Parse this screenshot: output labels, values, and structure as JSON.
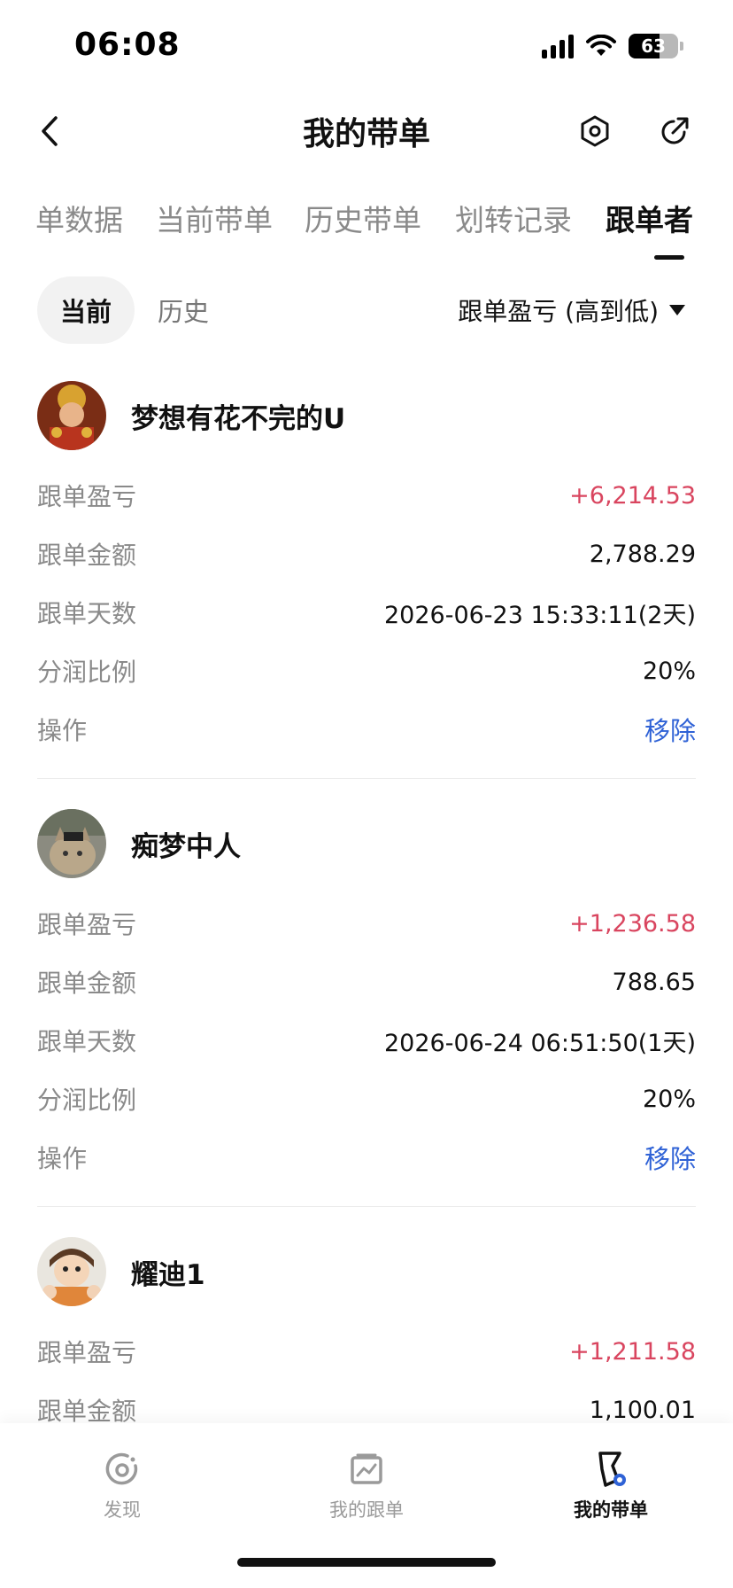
{
  "status_bar": {
    "time": "06:08",
    "battery": "63",
    "battery_level_pct": 63
  },
  "nav": {
    "title": "我的带单",
    "back_icon": "chevron-left-icon",
    "settings_icon": "hexagon-gear-icon",
    "share_icon": "share-arrow-icon"
  },
  "tabs": [
    {
      "label": "单数据"
    },
    {
      "label": "当前带单"
    },
    {
      "label": "历史带单"
    },
    {
      "label": "划转记录"
    },
    {
      "label": "跟单者"
    }
  ],
  "active_tab": "跟单者",
  "filter": {
    "current": "当前",
    "history": "历史",
    "sort_label": "跟单盈亏 (高到低)"
  },
  "row_labels": {
    "pnl": "跟单盈亏",
    "amount": "跟单金额",
    "days": "跟单天数",
    "share_ratio": "分润比例",
    "action": "操作"
  },
  "followers": [
    {
      "name": "梦想有花不完的U",
      "pnl": "+6,214.53",
      "amount": "2,788.29",
      "days": "2026-06-23 15:33:11(2天)",
      "share_ratio": "20%",
      "action": "移除"
    },
    {
      "name": "痴梦中人",
      "pnl": "+1,236.58",
      "amount": "788.65",
      "days": "2026-06-24 06:51:50(1天)",
      "share_ratio": "20%",
      "action": "移除"
    },
    {
      "name": "耀迪1",
      "pnl": "+1,211.58",
      "amount": "1,100.01"
    }
  ],
  "bottom_nav": [
    {
      "label": "发现",
      "icon": "discover-icon"
    },
    {
      "label": "我的跟单",
      "icon": "chart-box-icon"
    },
    {
      "label": "我的带单",
      "icon": "lead-trade-icon"
    }
  ],
  "colors": {
    "profit": "#d9455f",
    "action": "#2f62d6",
    "muted": "#8a8a8a",
    "text": "#111111"
  }
}
